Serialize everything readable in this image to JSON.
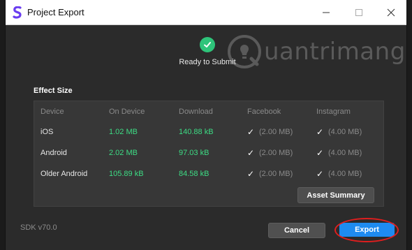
{
  "window": {
    "title": "Project Export",
    "controls": {
      "minimize": "minimize-icon",
      "maximize": "maximize-icon",
      "close": "close-icon"
    }
  },
  "status": {
    "text": "Ready to Submit",
    "icon": "check-circle-icon",
    "color": "#2ec47a"
  },
  "watermark": {
    "text": "uantrimang"
  },
  "effect_size": {
    "label": "Effect Size",
    "columns": [
      "Device",
      "On Device",
      "Download",
      "Facebook",
      "Instagram"
    ],
    "rows": [
      {
        "device": "iOS",
        "on_device": "1.02 MB",
        "download": "140.88 kB",
        "facebook_check": "✓",
        "facebook_limit": "(2.00 MB)",
        "instagram_check": "✓",
        "instagram_limit": "(4.00 MB)"
      },
      {
        "device": "Android",
        "on_device": "2.02 MB",
        "download": "97.03 kB",
        "facebook_check": "✓",
        "facebook_limit": "(2.00 MB)",
        "instagram_check": "✓",
        "instagram_limit": "(4.00 MB)"
      },
      {
        "device": "Older Android",
        "on_device": "105.89 kB",
        "download": "84.58 kB",
        "facebook_check": "✓",
        "facebook_limit": "(2.00 MB)",
        "instagram_check": "✓",
        "instagram_limit": "(4.00 MB)"
      }
    ],
    "asset_summary_label": "Asset Summary"
  },
  "footer": {
    "sdk_version": "SDK v70.0",
    "cancel_label": "Cancel",
    "export_label": "Export"
  },
  "colors": {
    "accent": "#1e8bf0",
    "value_green": "#3ddc84",
    "highlight": "#e01e1e"
  }
}
